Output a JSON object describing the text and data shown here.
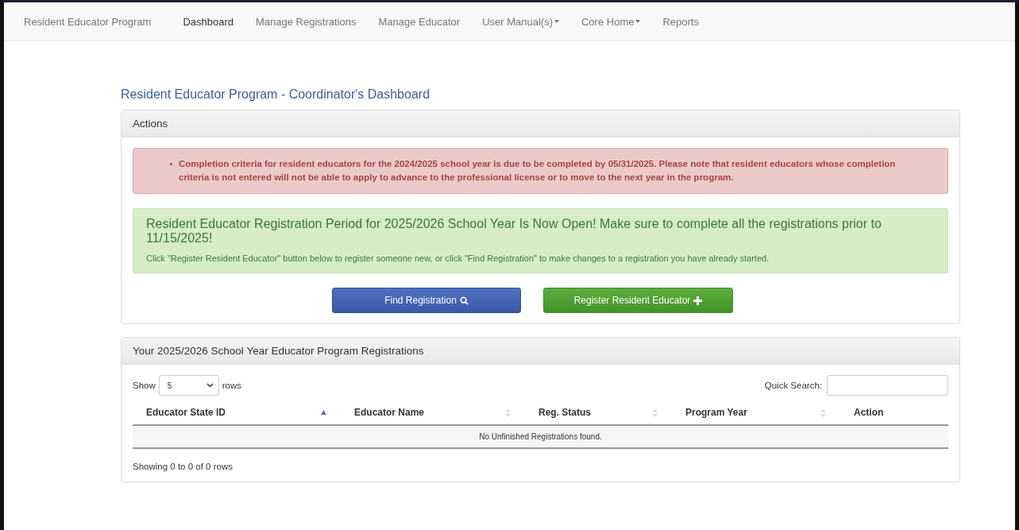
{
  "navbar": {
    "brand": "Resident Educator Program",
    "items": [
      {
        "label": "Dashboard",
        "selected": true,
        "dropdown": false
      },
      {
        "label": "Manage Registrations",
        "selected": false,
        "dropdown": false
      },
      {
        "label": "Manage Educator",
        "selected": false,
        "dropdown": false
      },
      {
        "label": "User Manual(s)",
        "selected": false,
        "dropdown": true
      },
      {
        "label": "Core Home",
        "selected": false,
        "dropdown": true
      },
      {
        "label": "Reports",
        "selected": false,
        "dropdown": false
      }
    ]
  },
  "page_title": "Resident Educator Program - Coordinator's Dashboard",
  "actions_panel": {
    "heading": "Actions",
    "alert": "Completion criteria for resident educators for the 2024/2025 school year is due to be completed by 05/31/2025. Please note that resident educators whose completion criteria is not entered will not be able to apply to advance to the professional license or to move to the next year in the program.",
    "notice": {
      "title": "Resident Educator Registration Period for 2025/2026 School Year Is Now Open! Make sure to complete all the registrations prior to 11/15/2025!",
      "text": "Click \"Register Resident Educator\" button below to register someone new, or click \"Find Registration\" to make changes to a registration you have already started."
    },
    "buttons": [
      {
        "label": "Find Registration",
        "kind": "find"
      },
      {
        "label": "Register Resident Educator",
        "kind": "add"
      }
    ]
  },
  "registrations_panel": {
    "heading": "Your 2025/2026 School Year Educator Program Registrations",
    "show_label": "Show",
    "page_size": "5",
    "rows_label": "rows",
    "search_label": "Quick Search:",
    "columns": [
      {
        "label": "Educator State ID",
        "sortable": true,
        "sorted": true
      },
      {
        "label": "Educator Name",
        "sortable": true,
        "sorted": false
      },
      {
        "label": "Reg. Status",
        "sortable": true,
        "sorted": false
      },
      {
        "label": "Program Year",
        "sortable": true,
        "sorted": false
      },
      {
        "label": "Action",
        "sortable": false
      }
    ],
    "empty_message": "No Unfinished Registrations found.",
    "footer": "Showing 0 to 0 of 0 rows"
  }
}
